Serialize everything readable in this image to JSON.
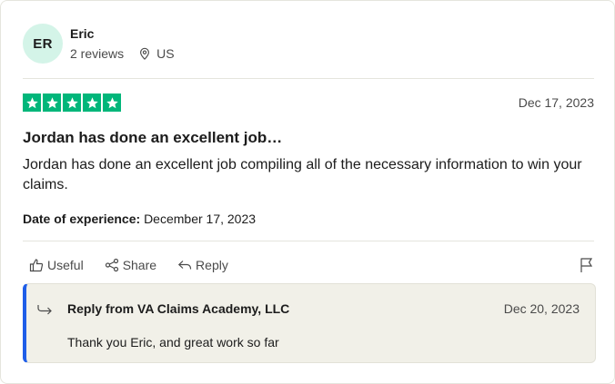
{
  "reviewer": {
    "initials": "ER",
    "name": "Eric",
    "reviews": "2 reviews",
    "location": "US"
  },
  "review": {
    "rating": 5,
    "date": "Dec 17, 2023",
    "title": "Jordan has done an excellent job…",
    "body": "Jordan has done an excellent job compiling all of the necessary information to win your claims.",
    "experience_label": "Date of experience:",
    "experience_date": "December 17, 2023"
  },
  "actions": {
    "useful": "Useful",
    "share": "Share",
    "reply": "Reply"
  },
  "company_reply": {
    "title": "Reply from VA Claims Academy, LLC",
    "date": "Dec 20, 2023",
    "text": "Thank you Eric, and great work so far"
  },
  "colors": {
    "star": "#00b67a",
    "avatar_bg": "#d4f4e8",
    "reply_accent": "#1f5ee8",
    "reply_bg": "#f1f0e8"
  }
}
